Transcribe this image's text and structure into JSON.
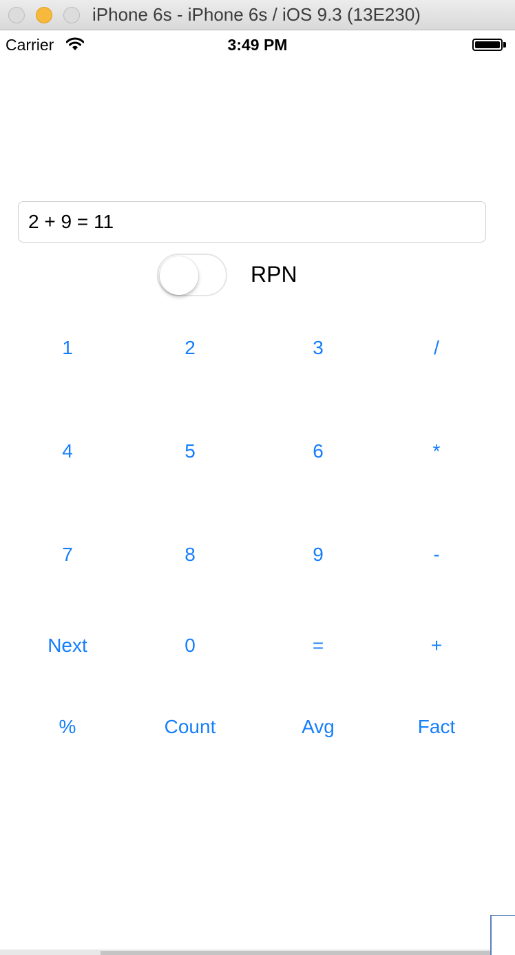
{
  "window": {
    "title": "iPhone 6s - iPhone 6s / iOS 9.3 (13E230)"
  },
  "statusbar": {
    "carrier": "Carrier",
    "time": "3:49 PM",
    "battery_level": 1.0
  },
  "display": {
    "value": "2 + 9 = 11"
  },
  "rpn": {
    "label": "RPN",
    "enabled": false
  },
  "keypad": {
    "rows": [
      [
        {
          "label": "1"
        },
        {
          "label": "2"
        },
        {
          "label": "3"
        },
        {
          "label": "/"
        }
      ],
      [
        {
          "label": "4"
        },
        {
          "label": "5"
        },
        {
          "label": "6"
        },
        {
          "label": "*"
        }
      ],
      [
        {
          "label": "7"
        },
        {
          "label": "8"
        },
        {
          "label": "9"
        },
        {
          "label": "-"
        }
      ],
      [
        {
          "label": "Next"
        },
        {
          "label": "0"
        },
        {
          "label": "="
        },
        {
          "label": "+"
        }
      ],
      [
        {
          "label": "%"
        },
        {
          "label": "Count"
        },
        {
          "label": "Avg"
        },
        {
          "label": "Fact"
        }
      ]
    ]
  },
  "colors": {
    "accent": "#147efb",
    "minimize": "#f6b93b"
  },
  "icons": {
    "wifi": "wifi-icon",
    "battery": "battery-icon"
  }
}
